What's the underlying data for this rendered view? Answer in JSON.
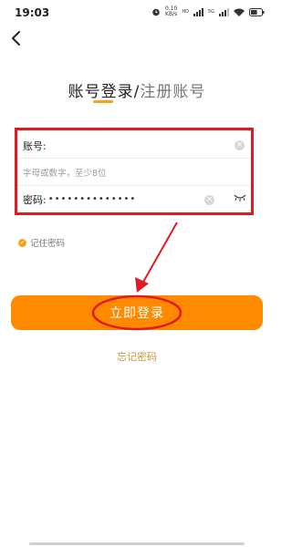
{
  "status_bar": {
    "time": "19:03",
    "speed_value": "0.10",
    "speed_unit": "KB/s",
    "hd_label": "HD",
    "network_label": "5G",
    "battery_level": 0.6
  },
  "header": {
    "back_icon": "chevron-left-icon",
    "title_active": "账号登录",
    "title_separator": "/",
    "title_inactive": "注册账号"
  },
  "form": {
    "account_label": "账号:",
    "account_value": "",
    "account_hint": "字母或数字，至少8位",
    "password_label": "密码:",
    "password_masked": "••••••••••••••",
    "clear_icon": "close-circle-icon",
    "visibility_icon": "eye-closed-icon"
  },
  "remember": {
    "label": "记住密码",
    "checked": true
  },
  "login_button_label": "立即登录",
  "forgot_password_label": "忘记密码",
  "colors": {
    "accent": "#f4a21e",
    "button": "#ff8a00",
    "annotation": "#e01b24",
    "link": "#c8963c"
  }
}
